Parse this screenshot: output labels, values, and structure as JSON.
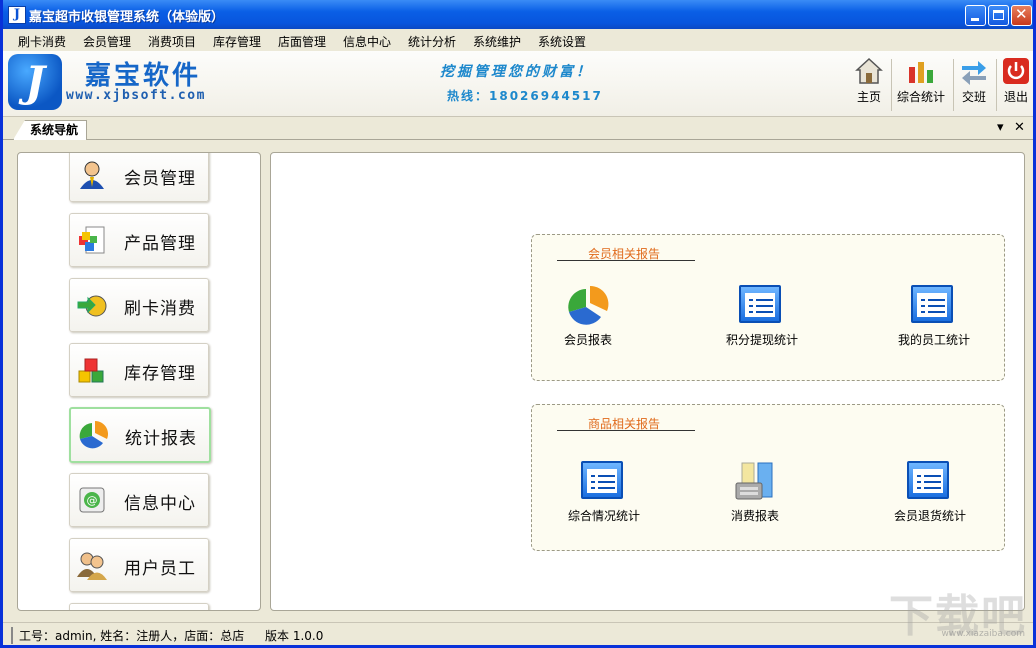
{
  "window": {
    "title": "嘉宝超市收银管理系统（体验版）"
  },
  "menu": [
    "刷卡消费",
    "会员管理",
    "消费项目",
    "库存管理",
    "店面管理",
    "信息中心",
    "统计分析",
    "系统维护",
    "系统设置"
  ],
  "header": {
    "logo_letter": "J",
    "brand_name": "嘉宝软件",
    "brand_url": "www.xjbsoft.com",
    "slogan": "挖掘管理您的财富！",
    "hotline": "热线：18026944517"
  },
  "toolbar": [
    {
      "label": "主页",
      "icon": "home-icon"
    },
    {
      "label": "综合统计",
      "icon": "bar-chart-icon"
    },
    {
      "label": "交班",
      "icon": "shift-exchange-icon"
    },
    {
      "label": "退出",
      "icon": "power-icon"
    }
  ],
  "nav_tab": {
    "label": "系统导航",
    "dropdown_icon": "▾",
    "close_icon": "✕"
  },
  "nav_items": [
    {
      "label": "会员管理",
      "icon": "member-icon",
      "active": false
    },
    {
      "label": "产品管理",
      "icon": "product-icon",
      "active": false
    },
    {
      "label": "刷卡消费",
      "icon": "swipe-card-icon",
      "active": false
    },
    {
      "label": "库存管理",
      "icon": "inventory-icon",
      "active": false
    },
    {
      "label": "统计报表",
      "icon": "pie-chart-icon",
      "active": true
    },
    {
      "label": "信息中心",
      "icon": "message-icon",
      "active": false
    },
    {
      "label": "用户员工",
      "icon": "users-icon",
      "active": false
    }
  ],
  "groups": [
    {
      "title": "会员相关报告",
      "reports": [
        {
          "label": "会员报表",
          "icon": "pie-chart-icon"
        },
        {
          "label": "积分提现统计",
          "icon": "list-doc-icon"
        },
        {
          "label": "我的员工统计",
          "icon": "list-doc-icon"
        }
      ]
    },
    {
      "title": "商品相关报告",
      "reports": [
        {
          "label": "综合情况统计",
          "icon": "list-doc-icon"
        },
        {
          "label": "消费报表",
          "icon": "register-icon"
        },
        {
          "label": "会员退货统计",
          "icon": "list-doc-icon"
        }
      ]
    }
  ],
  "status": {
    "user_info": "工号：admin, 姓名：注册人，店面：总店",
    "version": "版本 1.0.0"
  },
  "watermark": {
    "text": "下载吧",
    "url": "www.xiazaiba.com"
  },
  "colors": {
    "titlebar": "#0a5fe6",
    "accent": "#1d88cc",
    "group_title": "#e06a1b",
    "active_border": "#9fe09f"
  }
}
